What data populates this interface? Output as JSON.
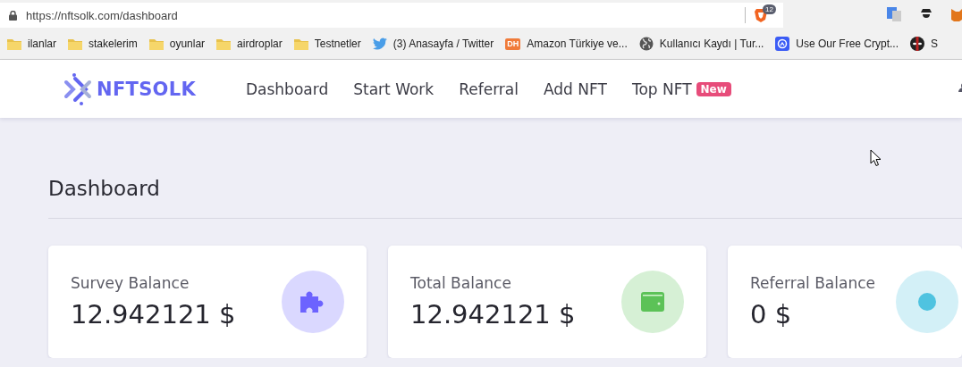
{
  "browser": {
    "url": "https://nftsolk.com/dashboard",
    "shield_count": "12",
    "bookmarks": [
      {
        "kind": "folder",
        "label": "ilanlar"
      },
      {
        "kind": "folder",
        "label": "stakelerim"
      },
      {
        "kind": "folder",
        "label": "oyunlar"
      },
      {
        "kind": "folder",
        "label": "airdroplar"
      },
      {
        "kind": "folder",
        "label": "Testnetler"
      },
      {
        "kind": "bird",
        "label": "(3) Anasayfa / Twitter"
      },
      {
        "kind": "letters",
        "icon_text": "DH",
        "label": "Amazon Türkiye ve..."
      },
      {
        "kind": "globe",
        "label": "Kullanıcı Kaydı | Tur..."
      },
      {
        "kind": "app",
        "label": "Use Our Free Crypt..."
      },
      {
        "kind": "mask",
        "label": "S"
      }
    ]
  },
  "nav": {
    "logo": "NFTSOLK",
    "links": [
      {
        "label": "Dashboard"
      },
      {
        "label": "Start Work"
      },
      {
        "label": "Referral"
      },
      {
        "label": "Add NFT"
      },
      {
        "label": "Top NFT",
        "badge": "New"
      }
    ]
  },
  "page": {
    "title": "Dashboard",
    "cards": [
      {
        "label": "Survey Balance",
        "value": "12.942121 $",
        "kind": "puzzle",
        "color": "#6c63ff"
      },
      {
        "label": "Total Balance",
        "value": "12.942121 $",
        "kind": "wallet",
        "color": "#5cc257"
      },
      {
        "label": "Referral Balance",
        "value": "0 $",
        "kind": "other",
        "color": "#4fc3e0"
      }
    ]
  }
}
